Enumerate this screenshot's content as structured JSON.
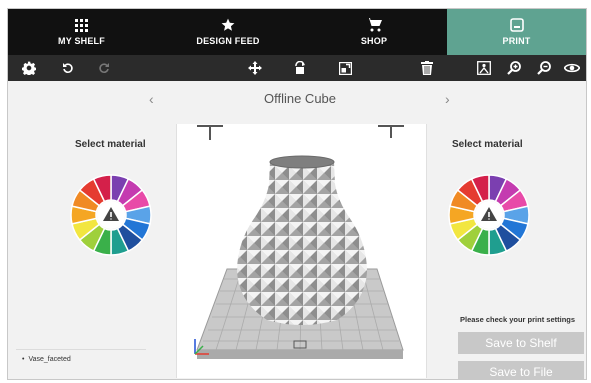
{
  "nav": {
    "tabs": [
      {
        "label": "MY SHELF",
        "icon": "grid-icon"
      },
      {
        "label": "DESIGN FEED",
        "icon": "star-icon"
      },
      {
        "label": "SHOP",
        "icon": "cart-icon"
      },
      {
        "label": "PRINT",
        "icon": "print-icon",
        "active": true
      }
    ],
    "active_color": "#5fa391"
  },
  "toolbar": {
    "icons": [
      "gear-icon",
      "undo-icon",
      "redo-icon",
      "move-icon",
      "rotate-icon",
      "scale-icon",
      "trash-icon",
      "layout-icon",
      "zoom-in-icon",
      "zoom-out-icon",
      "view-icon"
    ]
  },
  "model": {
    "title": "Offline Cube",
    "prev_arrow": "‹",
    "next_arrow": "›"
  },
  "materials": {
    "left_label": "Select material",
    "right_label": "Select material",
    "wheel_colors": [
      "#7b3fb0",
      "#c43bb0",
      "#e84aa8",
      "#5aa3e8",
      "#2276d6",
      "#1f4f9e",
      "#1f9e8f",
      "#3ab04a",
      "#9fd03b",
      "#f2e640",
      "#f5a623",
      "#f08a24",
      "#e53b30",
      "#d4204a"
    ],
    "center_icon": "warning-icon"
  },
  "files": {
    "items": [
      "Vase_faceted"
    ]
  },
  "print": {
    "notice": "Please check your print settings",
    "save_shelf_label": "Save to Shelf",
    "save_file_label": "Save to File",
    "button_color": "#c8c8c8"
  }
}
